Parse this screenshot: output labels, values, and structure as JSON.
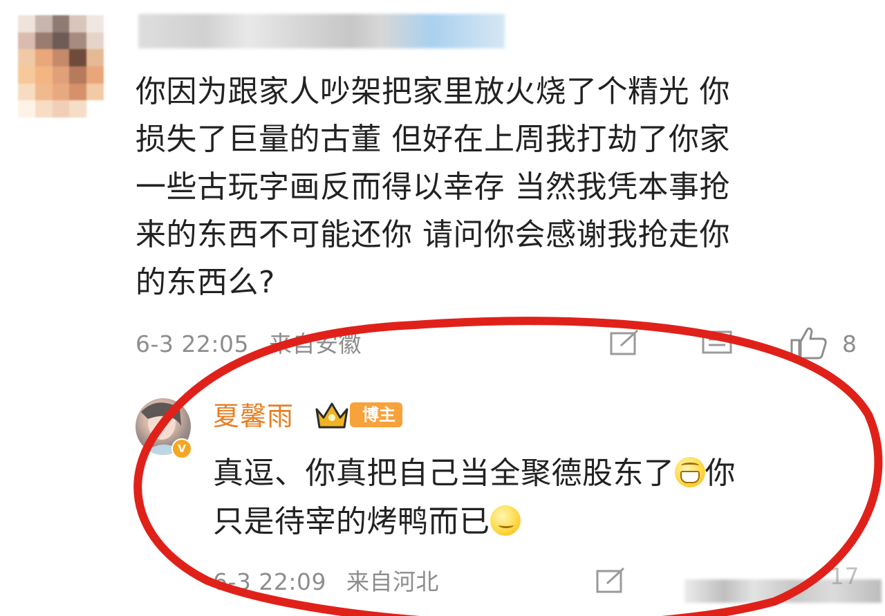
{
  "comment": {
    "lines": [
      "你因为跟家人吵架把家里放火烧了个精光 你",
      "损失了巨量的古董  但好在上周我打劫了你家",
      "一些古玩字画反而得以幸存  当然我凭本事抢",
      "来的东西不可能还你   请问你会感谢我抢走你",
      "的东西么?"
    ],
    "timestamp": "6-3 22:05",
    "source": "来自安徽",
    "like_count": "8"
  },
  "reply": {
    "author": "夏馨雨",
    "badge": "博主",
    "line1_a": "真逗、你真把自己当全聚德股东了",
    "line1_b": "你",
    "line2": "只是待宰的烤鸭而已",
    "timestamp": "6-3 22:09",
    "source": "来自河北",
    "like_count": "17"
  },
  "icons": {
    "share": "share-icon",
    "comment": "comment-icon",
    "like": "thumbs-up-icon",
    "emoji_grin": "grin-emoji",
    "emoji_sly": "smirk-emoji",
    "crown": "crown-icon",
    "verified": "verified-v-icon"
  },
  "colors": {
    "author_name": "#e67e22",
    "host_badge": "#f7a23b",
    "annotation_circle": "#e0211a",
    "meta_text": "#8d8d8d"
  }
}
